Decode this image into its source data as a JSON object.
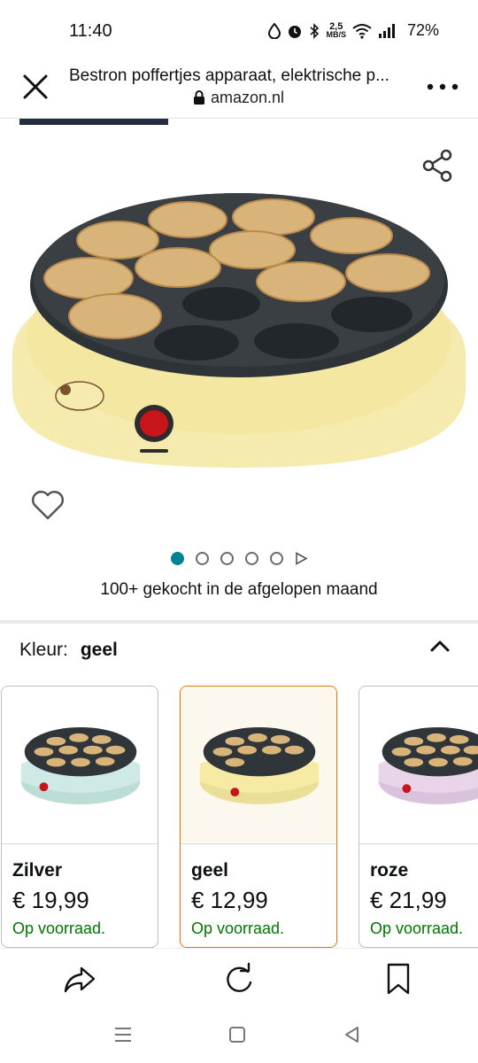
{
  "status": {
    "time": "11:40",
    "net_speed_value": "2,5",
    "net_speed_unit": "MB/S",
    "battery": "72%"
  },
  "browser": {
    "title": "Bestron poffertjes apparaat, elektrische p...",
    "url": "amazon.nl"
  },
  "product": {
    "image_count": 5,
    "active_image_index": 0,
    "bought_text": "100+ gekocht in de afgelopen maand"
  },
  "color_selector": {
    "label": "Kleur:",
    "selected_value": "geel",
    "options": [
      {
        "name": "Zilver",
        "price": "€ 19,99",
        "stock": "Op voorraad.",
        "body_color": "#cfeae6"
      },
      {
        "name": "geel",
        "price": "€ 12,99",
        "stock": "Op voorraad.",
        "body_color": "#f7eba4"
      },
      {
        "name": "roze",
        "price": "€ 21,99",
        "stock": "Op voorraad.",
        "body_color": "#e9d4ea"
      }
    ]
  },
  "colors": {
    "accent_teal": "#008296",
    "selected_border": "#e77600",
    "in_stock_green": "#007600",
    "header_navy": "#232f3e"
  },
  "icons": {
    "close": "close-icon",
    "menu": "more-vert-icon",
    "share": "share-icon",
    "wishlist": "heart-icon",
    "collapse": "chevron-up-icon",
    "forward": "share-arrow-icon",
    "reload": "reload-icon",
    "bookmark": "bookmark-icon"
  }
}
